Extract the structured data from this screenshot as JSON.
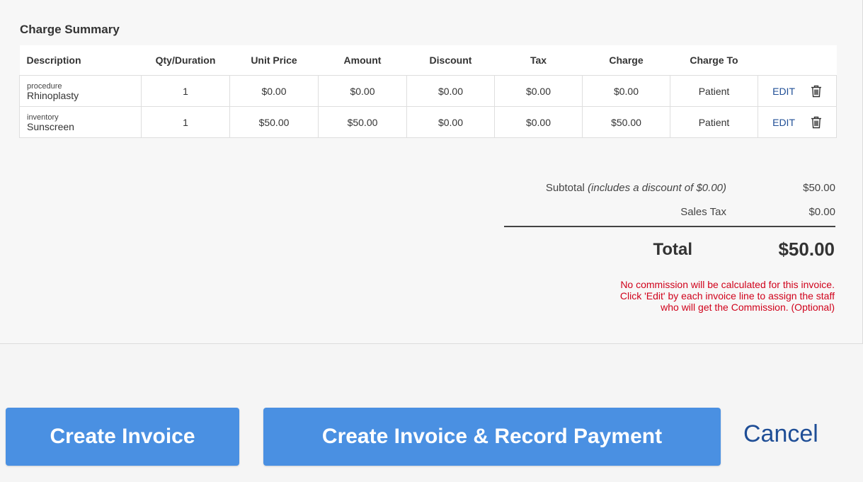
{
  "summary": {
    "title": "Charge Summary",
    "columns": [
      "Description",
      "Qty/Duration",
      "Unit Price",
      "Amount",
      "Discount",
      "Tax",
      "Charge",
      "Charge To"
    ],
    "rows": [
      {
        "category": "procedure",
        "name": "Rhinoplasty",
        "qty": "1",
        "unit_price": "$0.00",
        "amount": "$0.00",
        "discount": "$0.00",
        "tax": "$0.00",
        "charge": "$0.00",
        "charge_to": "Patient",
        "edit_label": "EDIT",
        "delete_icon": "trash-icon"
      },
      {
        "category": "inventory",
        "name": "Sunscreen",
        "qty": "1",
        "unit_price": "$50.00",
        "amount": "$50.00",
        "discount": "$0.00",
        "tax": "$0.00",
        "charge": "$50.00",
        "charge_to": "Patient",
        "edit_label": "EDIT",
        "delete_icon": "trash-icon"
      }
    ]
  },
  "totals": {
    "subtotal_label": "Subtotal",
    "subtotal_note": "(includes a discount of $0.00)",
    "subtotal_value": "$50.00",
    "sales_tax_label": "Sales Tax",
    "sales_tax_value": "$0.00",
    "total_label": "Total",
    "total_value": "$50.00"
  },
  "notice": {
    "line1": "No commission will be calculated for this invoice.",
    "line2": "Click 'Edit' by each invoice line to assign the staff",
    "line3": "who will get the Commission. (Optional)",
    "color": "#d0021b"
  },
  "actions": {
    "create_invoice": "Create Invoice",
    "create_invoice_payment": "Create Invoice & Record Payment",
    "cancel": "Cancel",
    "button_color": "#4a90e2",
    "link_color": "#1f4e96"
  }
}
